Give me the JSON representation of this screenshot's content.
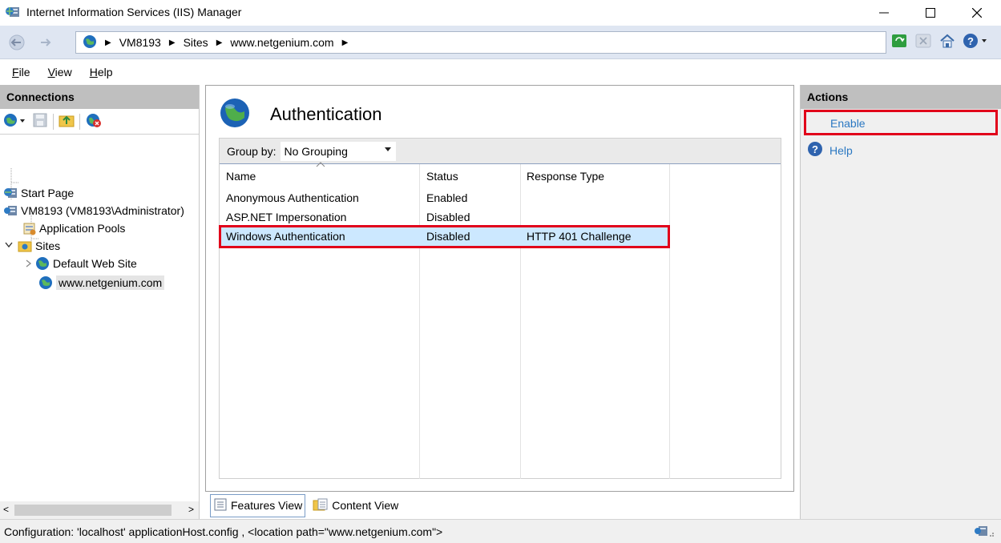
{
  "window": {
    "title": "Internet Information Services (IIS) Manager"
  },
  "address": {
    "crumbs": [
      "VM8193",
      "Sites",
      "www.netgenium.com"
    ]
  },
  "menu": [
    "File",
    "View",
    "Help"
  ],
  "connections": {
    "header": "Connections",
    "tree": [
      {
        "label": "Start Page",
        "icon": "start-page-icon"
      },
      {
        "label": "VM8193 (VM8193\\Administrator)",
        "icon": "server-icon"
      },
      {
        "label": "Application Pools",
        "icon": "app-pools-icon"
      },
      {
        "label": "Sites",
        "icon": "folder-icon"
      },
      {
        "label": "Default Web Site",
        "icon": "globe-icon"
      },
      {
        "label": "www.netgenium.com",
        "icon": "globe-icon"
      }
    ]
  },
  "feature": {
    "title": "Authentication",
    "group_by_label": "Group by:",
    "group_by_value": "No Grouping",
    "columns": [
      "Name",
      "Status",
      "Response Type"
    ],
    "rows": [
      {
        "name": "Anonymous Authentication",
        "status": "Enabled",
        "response": ""
      },
      {
        "name": "ASP.NET Impersonation",
        "status": "Disabled",
        "response": ""
      },
      {
        "name": "Windows Authentication",
        "status": "Disabled",
        "response": "HTTP 401 Challenge"
      }
    ]
  },
  "view_tabs": [
    "Features View",
    "Content View"
  ],
  "actions": {
    "header": "Actions",
    "items": [
      "Enable",
      "Help"
    ]
  },
  "status": {
    "text": "Configuration: 'localhost' applicationHost.config , <location path=\"www.netgenium.com\">"
  },
  "colors": {
    "highlight": "#e1001a",
    "selected_row": "#cce8ff",
    "link": "#2b78c2"
  }
}
